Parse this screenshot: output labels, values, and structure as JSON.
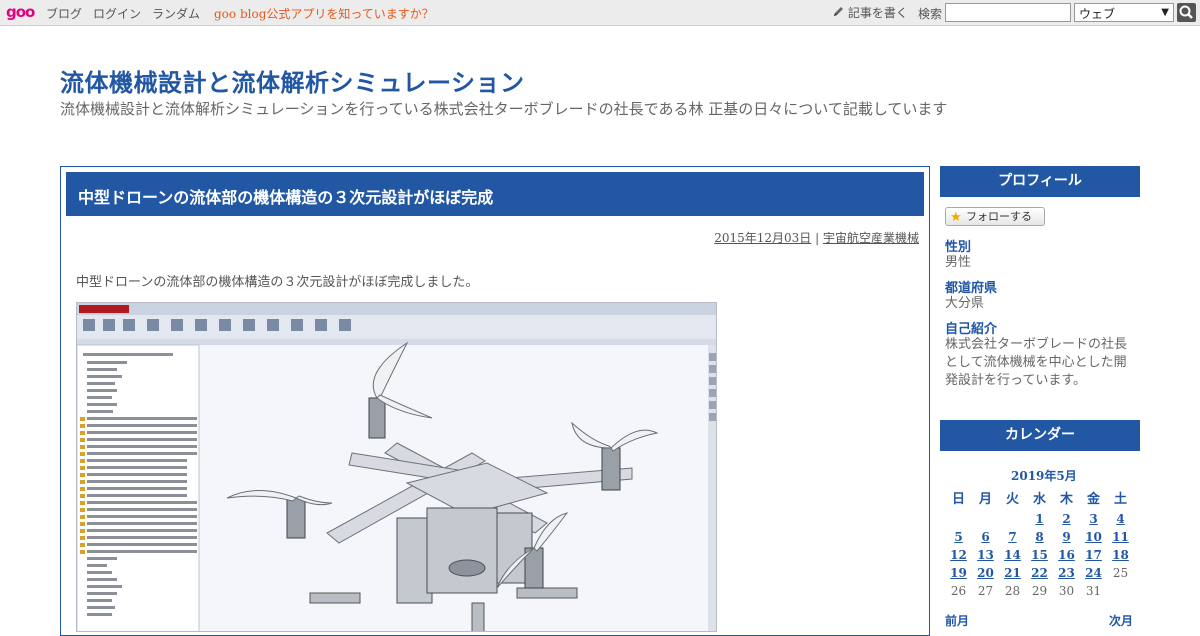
{
  "topbar": {
    "logo": "goo",
    "nav": [
      "ブログ",
      "ログイン",
      "ランダム"
    ],
    "promo": "goo blog公式アプリを知っていますか？",
    "write": "記事を書く",
    "search_label": "検索",
    "search_value": "",
    "select_value": "ウェブ"
  },
  "site": {
    "title": "流体機械設計と流体解析シミュレーション",
    "description": "流体機械設計と流体解析シミュレーションを行っている株式会社ターボブレードの社長である林 正基の日々について記載しています"
  },
  "entry": {
    "title": "中型ドローンの流体部の機体構造の３次元設計がほぼ完成",
    "date": "2015年12月03日",
    "separator": "|",
    "category": "宇宙航空産業機械",
    "body": "中型ドローンの流体部の機体構造の３次元設計がほぼ完成しました。"
  },
  "sidebar": {
    "profile_heading": "プロフィール",
    "follow_label": "フォローする",
    "profile": [
      {
        "label": "性別",
        "value": "男性"
      },
      {
        "label": "都道府県",
        "value": "大分県"
      },
      {
        "label": "自己紹介",
        "value": "株式会社ターボブレードの社長として流体機械を中心とした開発設計を行っています。"
      }
    ],
    "calendar_heading": "カレンダー",
    "calendar": {
      "month": "2019年5月",
      "weekdays": [
        "日",
        "月",
        "火",
        "水",
        "木",
        "金",
        "土"
      ],
      "weeks": [
        [
          "",
          "",
          "",
          "1",
          "2",
          "3",
          "4"
        ],
        [
          "5",
          "6",
          "7",
          "8",
          "9",
          "10",
          "11"
        ],
        [
          "12",
          "13",
          "14",
          "15",
          "16",
          "17",
          "18"
        ],
        [
          "19",
          "20",
          "21",
          "22",
          "23",
          "24",
          "25"
        ],
        [
          "26",
          "27",
          "28",
          "29",
          "30",
          "31",
          ""
        ]
      ],
      "linked_days": [
        "1",
        "2",
        "3",
        "4",
        "5",
        "6",
        "7",
        "8",
        "9",
        "10",
        "11",
        "12",
        "13",
        "14",
        "15",
        "16",
        "17",
        "18",
        "19",
        "20",
        "21",
        "22",
        "23",
        "24"
      ],
      "prev": "前月",
      "next": "次月"
    }
  },
  "colors": {
    "brand_blue": "#2257a4",
    "promo_orange": "#e8591a",
    "goo_pink": "#e4007f"
  }
}
